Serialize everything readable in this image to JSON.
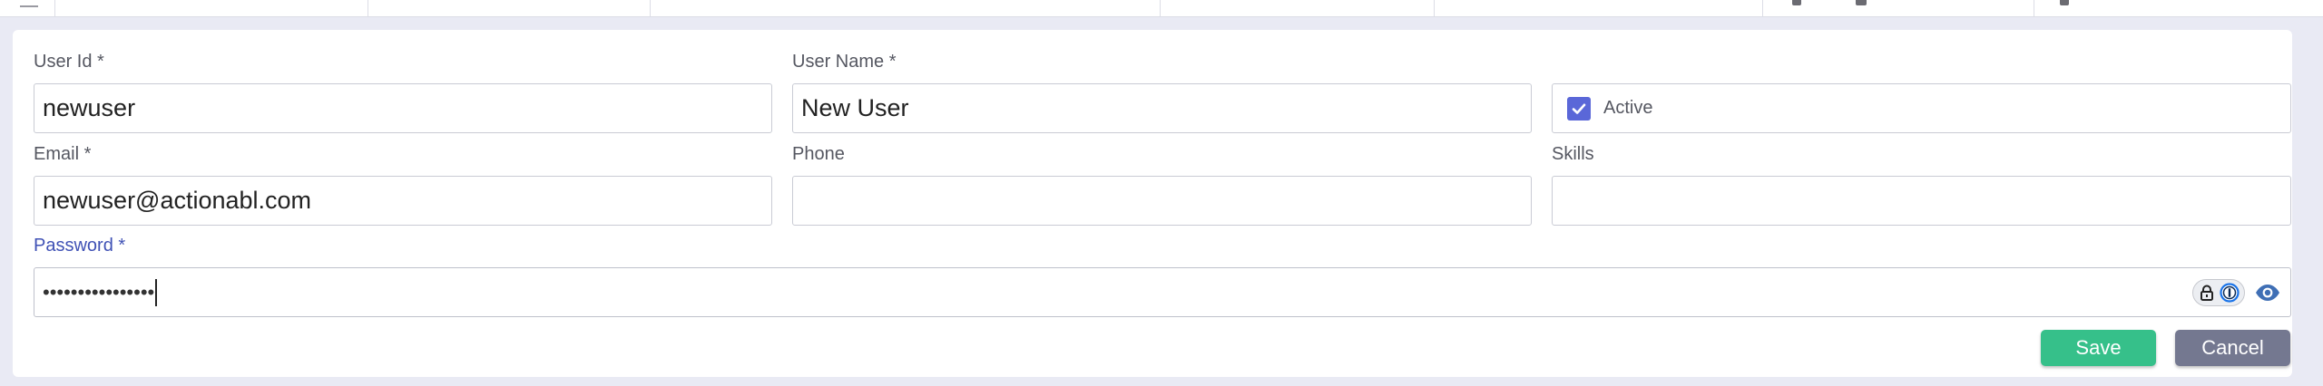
{
  "form": {
    "user_id": {
      "label": "User Id *",
      "value": "newuser"
    },
    "user_name": {
      "label": "User Name *",
      "value": "New User"
    },
    "active": {
      "label": "Active",
      "checked": true
    },
    "email": {
      "label": "Email *",
      "value": "newuser@actionabl.com"
    },
    "phone": {
      "label": "Phone",
      "value": ""
    },
    "skills": {
      "label": "Skills",
      "value": ""
    },
    "password": {
      "label": "Password *",
      "masked_value": "••••••••••••••••"
    }
  },
  "actions": {
    "save_label": "Save",
    "cancel_label": "Cancel"
  },
  "icons": {
    "password_manager": "lock-icon",
    "password_manager_logo": "1password-icon",
    "toggle_visibility": "eye-icon"
  },
  "colors": {
    "accent": "#3f51b5",
    "checkbox": "#5a67d8",
    "save": "#36c08a",
    "cancel": "#747890",
    "background": "#e9eaf4"
  }
}
